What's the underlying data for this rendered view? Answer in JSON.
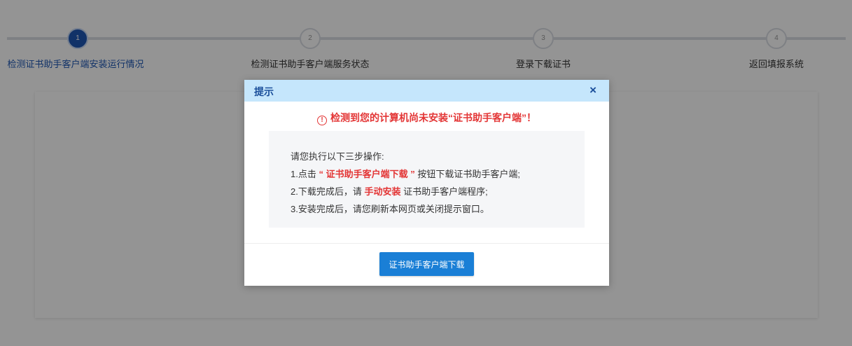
{
  "stepper": {
    "steps": [
      {
        "number": "1",
        "label": "检测证书助手客户端安装运行情况",
        "state": "active"
      },
      {
        "number": "2",
        "label": "检测证书助手客户端服务状态",
        "state": "pending"
      },
      {
        "number": "3",
        "label": "登录下载证书",
        "state": "pending"
      },
      {
        "number": "4",
        "label": "返回填报系统",
        "state": "pending"
      }
    ]
  },
  "dialog": {
    "title": "提示",
    "close_icon": "×",
    "warning_icon": "!",
    "warning": "检测到您的计算机尚未安装“证书助手客户端”！",
    "intro": "请您执行以下三步操作:",
    "step1": {
      "pre": "1.点击",
      "highlight": "“ 证书助手客户端下载 ”",
      "post": "按钮下载证书助手客户端;"
    },
    "step2": {
      "pre": "2.下载完成后，请",
      "highlight": "手动安装",
      "post": "证书助手客户端程序;"
    },
    "step3": "3.安装完成后，请您刷新本网页或关闭提示窗口。",
    "download_label": "证书助手客户端下载"
  },
  "colors": {
    "accent": "#1e57b4",
    "header_bg": "#c5e6fc",
    "warning": "#e33535",
    "button": "#1a7fd6"
  }
}
